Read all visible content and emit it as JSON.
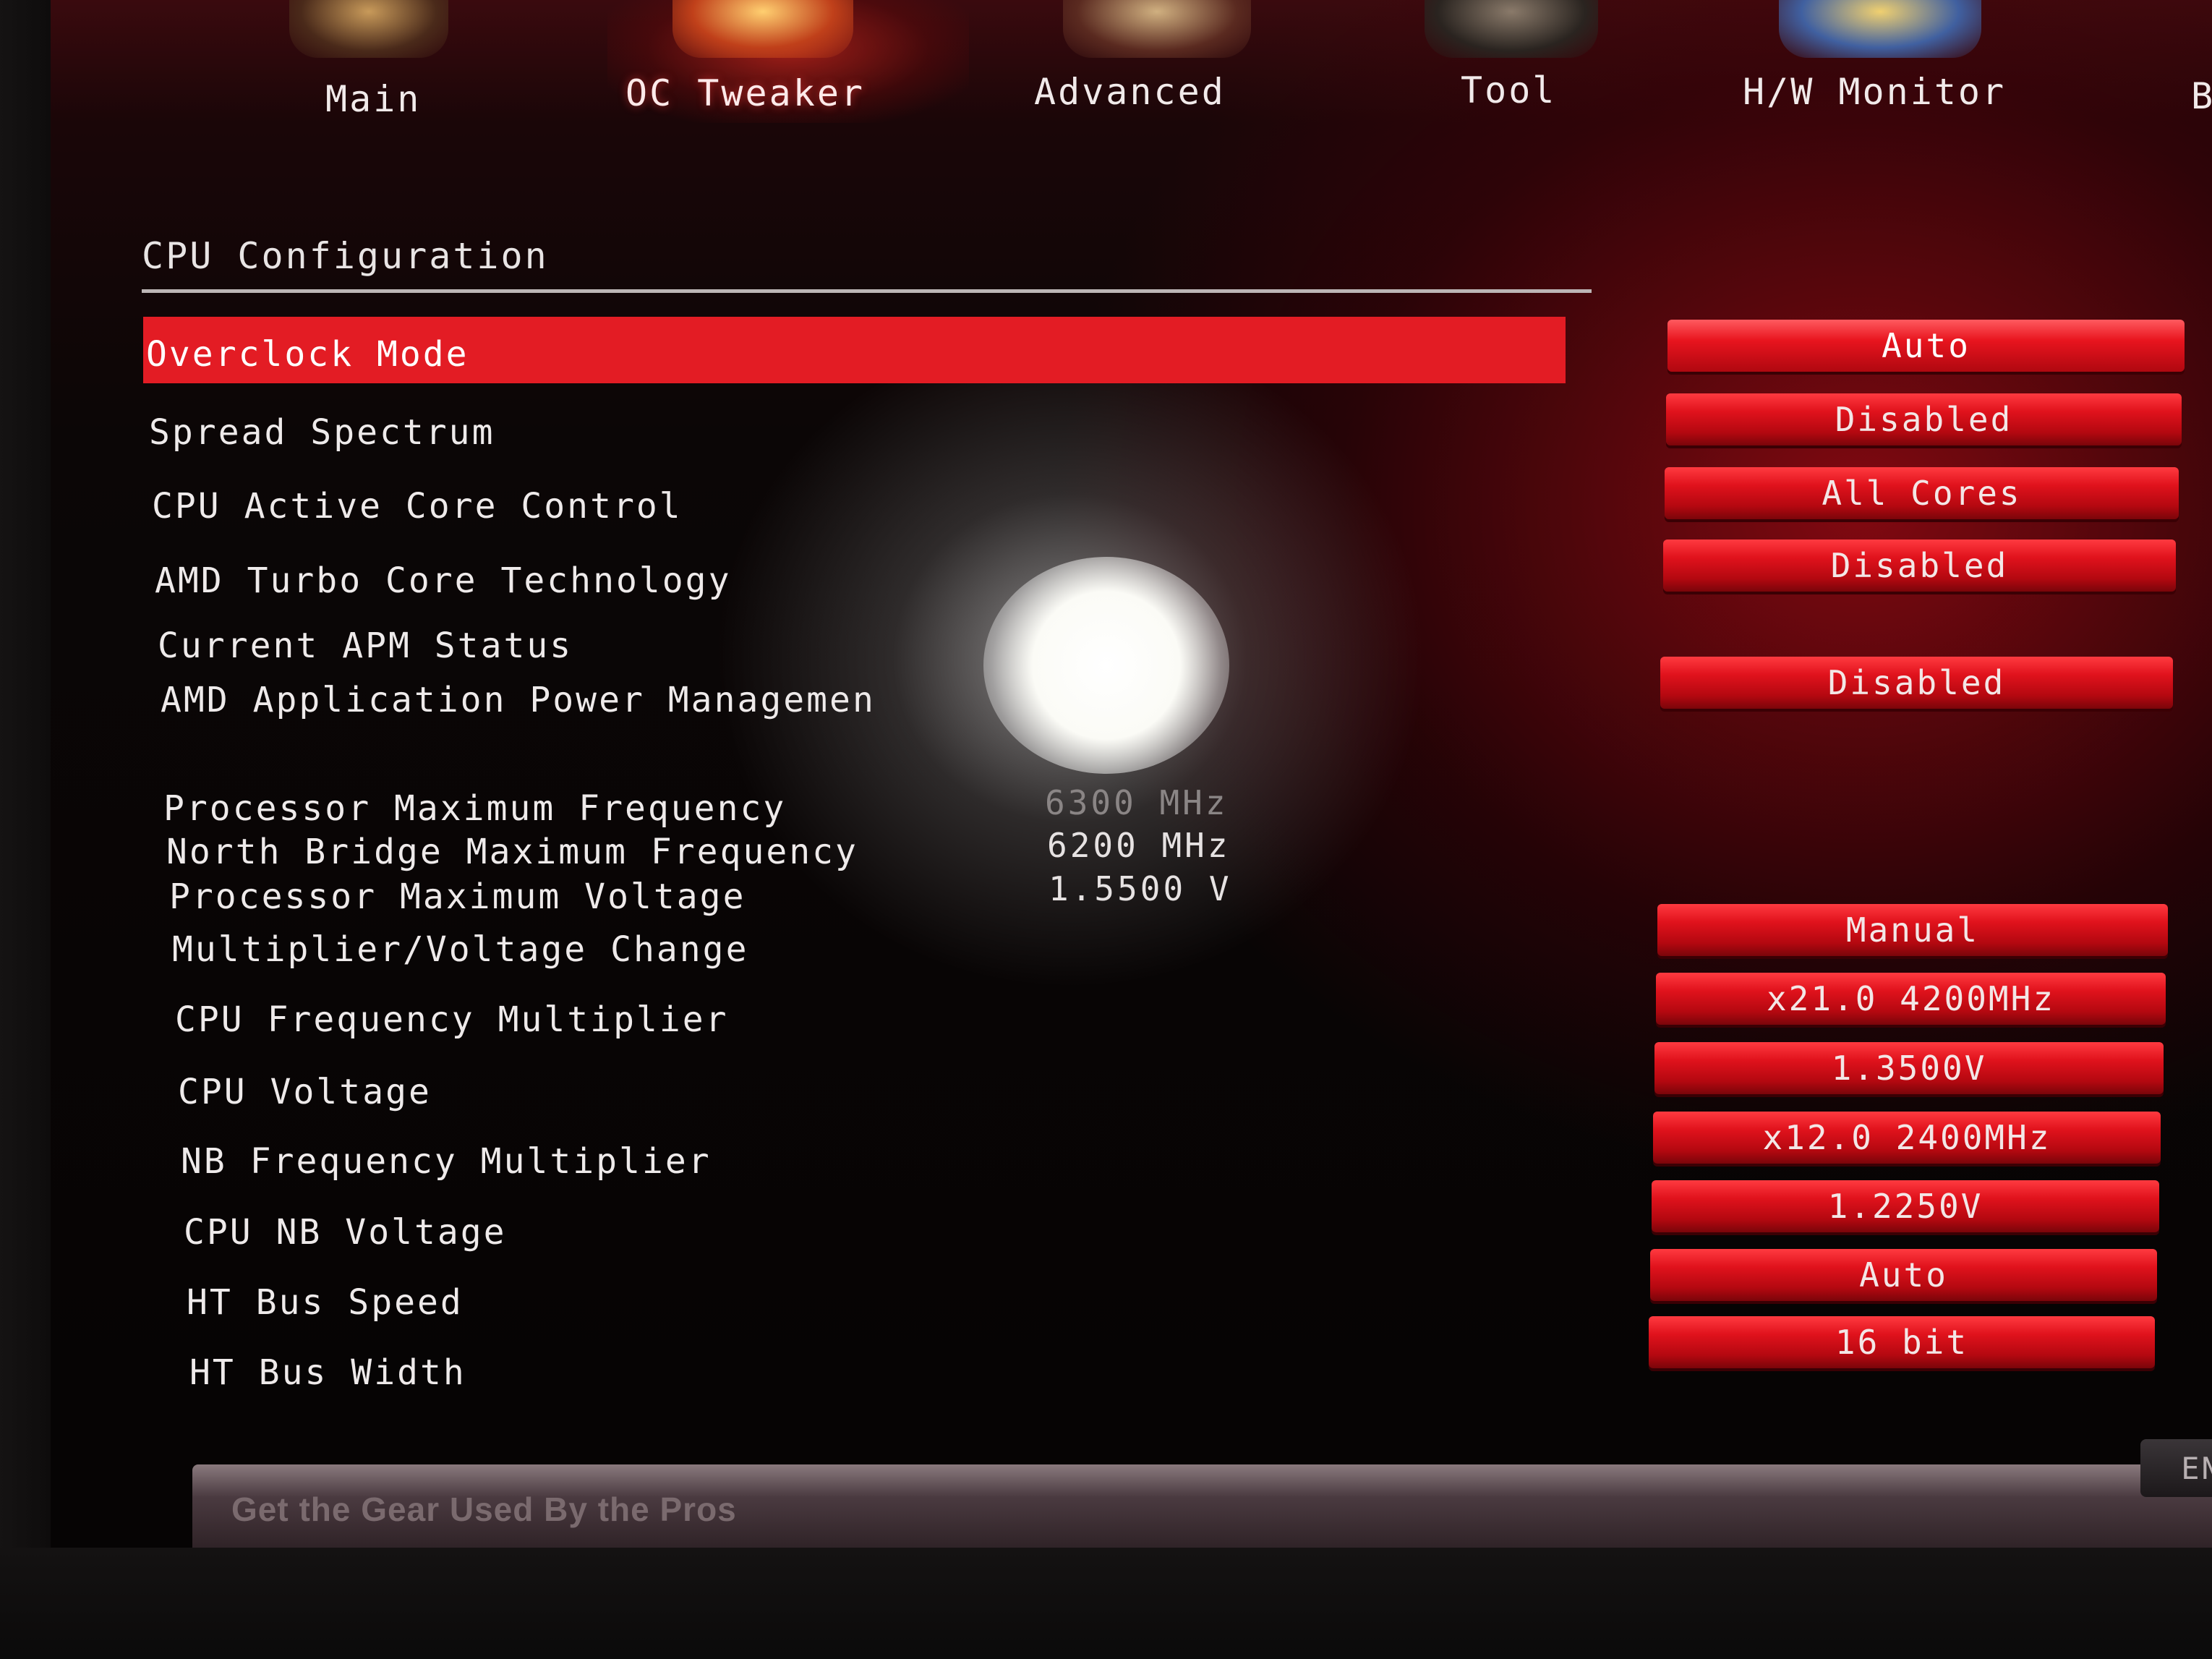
{
  "nav": {
    "tabs": [
      {
        "label": "Main"
      },
      {
        "label": "OC Tweaker"
      },
      {
        "label": "Advanced"
      },
      {
        "label": "Tool"
      },
      {
        "label": "H/W Monitor"
      },
      {
        "label": "B"
      }
    ],
    "active_tab": "OC Tweaker"
  },
  "section": {
    "title": "CPU Configuration"
  },
  "settings": [
    {
      "label": "Overclock Mode",
      "value": "Auto"
    },
    {
      "label": "Spread Spectrum",
      "value": "Disabled"
    },
    {
      "label": "CPU Active Core Control",
      "value": "All Cores"
    },
    {
      "label": "AMD Turbo Core Technology",
      "value": "Disabled"
    },
    {
      "label": "Current APM Status"
    },
    {
      "label": "AMD Application Power Managemen",
      "value": "Disabled"
    }
  ],
  "info": [
    {
      "label": "Processor Maximum Frequency",
      "value": "6300 MHz"
    },
    {
      "label": "North Bridge Maximum Frequency",
      "value": "6200 MHz"
    },
    {
      "label": "Processor Maximum Voltage",
      "value": "1.5500 V"
    }
  ],
  "settings2": [
    {
      "label": "Multiplier/Voltage Change",
      "value": "Manual"
    },
    {
      "label": "CPU Frequency Multiplier",
      "value": "x21.0 4200MHz"
    },
    {
      "label": "CPU Voltage",
      "value": "1.3500V"
    },
    {
      "label": "NB Frequency Multiplier",
      "value": "x12.0 2400MHz"
    },
    {
      "label": "CPU NB Voltage",
      "value": "1.2250V"
    },
    {
      "label": "HT Bus Speed",
      "value": "Auto"
    },
    {
      "label": "HT Bus Width",
      "value": "16 bit"
    }
  ],
  "footer": {
    "slogan": "Get the Gear Used By the Pros",
    "language": "EN"
  },
  "colors": {
    "accent": "#e31c24",
    "background": "#060404",
    "text": "#eeeaea"
  },
  "icons": {
    "scroll_down": "▼"
  }
}
